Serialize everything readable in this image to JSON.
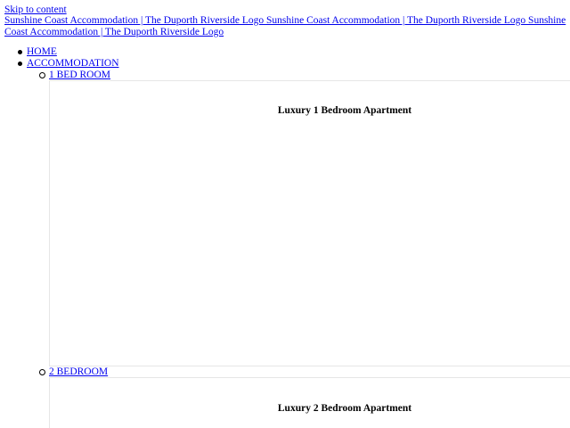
{
  "header": {
    "skip_link": "Skip to content",
    "logo_text": "Sunshine Coast Accommodation | The Duporth Riverside Logo Sunshine Coast Accommodation | The Duporth Riverside Logo Sunshine Coast Accommodation | The Duporth Riverside Logo"
  },
  "nav": {
    "items": [
      {
        "label": "HOME"
      },
      {
        "label": "ACCOMMODATION"
      }
    ],
    "submenu": [
      {
        "label": "1 BED ROOM",
        "panel_title": "Luxury 1 Bedroom Apartment"
      },
      {
        "label": "2 BEDROOM",
        "panel_title": "Luxury 2 Bedroom Apartment"
      }
    ]
  }
}
